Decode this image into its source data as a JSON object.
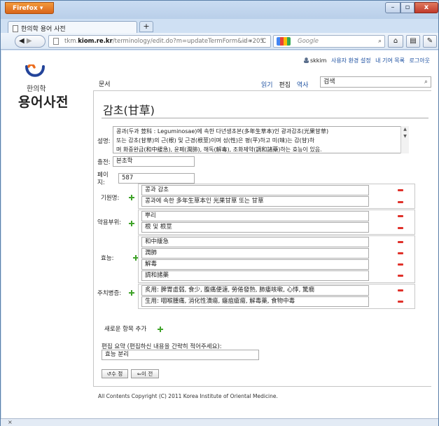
{
  "browser": {
    "app_button": "Firefox",
    "tab_title": "한의학 용어 사전",
    "new_tab": "+",
    "url_prefix": "tkm.",
    "url_domain": "kiom.re.kr",
    "url_path": "/terminology/edit.do?m=updateTermForm&id=205",
    "search_placeholder": "Google",
    "status_text": "×"
  },
  "userbar": {
    "username": "skkim",
    "links": [
      "사용자 환경 설정",
      "내 기여 목록",
      "로그아웃"
    ]
  },
  "logo": {
    "small": "한의학",
    "big": "용어사전"
  },
  "nav": {
    "doc_tab": "문서",
    "read": "읽기",
    "edit": "편집",
    "history": "역사",
    "search_value": "검색"
  },
  "term": {
    "title": "감초(甘草)",
    "description_label": "설명:",
    "description_lines": [
      "콩과(두과 荳科 : Leguminosae)에 속한 다년생초본(多年生草本)인 광과감초(光果甘草)",
      "또는 감초(甘草)의 근(根) 및 근경(根莖)이며 성(性)은 평(平)하고 미(味)는 감(甘)하",
      "며 화중완급(和中緩急), 윤폐(潤肺), 해독(解毒), 조화제약(調和諸藥)하는 효능이 있음."
    ],
    "source_label": "출전:",
    "source_value": "본초학",
    "page_label_1": "페이",
    "page_label_2": "지:",
    "page_value": "587",
    "origin_label": "기원명:",
    "origin_values": [
      "콩과 감초",
      "콩과에 속한 多年生草本인 光果甘草 또는 甘草"
    ],
    "part_label": "약용부위:",
    "part_values": [
      "뿌리",
      "根 및 根莖"
    ],
    "effect_label": "효능:",
    "effect_values": [
      "和中緩急",
      "潤肺",
      "解毒",
      "調和諸藥"
    ],
    "indication_label": "주치병증:",
    "indication_values": [
      "炙用: 脾胃虛弱, 食少, 腹痛便溏, 勞倦發熱, 肺痿咳嗽, 心悸, 驚癇",
      "生用: 咽喉腫痛, 消化性潰瘍, 癰疽瘡瘍, 解毒藥, 食物中毒"
    ],
    "add_item_label": "새로운 항목 추가",
    "summary_label": "편집 요약 (편집하신 내용을 간략히 적어주세요):",
    "summary_value": "효능 분리",
    "save_button": "수 정",
    "back_button": "이 전"
  },
  "footer": {
    "copyright": "All Contents Copyright (C) 2011 Korea Institute of Oriental Medicine."
  },
  "colors": {
    "link": "#1b4fa0",
    "add": "#3fa329",
    "remove": "#e0312a",
    "logo_orange": "#ec6d1e",
    "logo_blue": "#23449a"
  }
}
